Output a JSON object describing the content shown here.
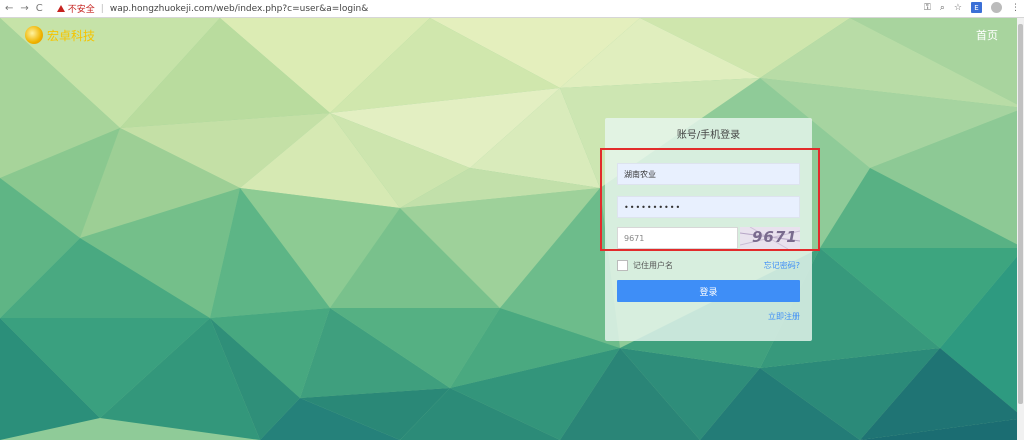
{
  "browser": {
    "back": "←",
    "forward": "→",
    "reload": "C",
    "security_label": "不安全",
    "separator": "|",
    "url": "wap.hongzhuokeji.com/web/index.php?c=user&a=login&",
    "icons": [
      "key-icon",
      "zoom-icon",
      "star-icon",
      "extension-icon",
      "profile-icon",
      "menu-icon"
    ]
  },
  "site": {
    "logo_text": "宏卓科技",
    "home_link": "首页"
  },
  "login": {
    "title": "账号/手机登录",
    "username_value": "湖南农业",
    "password_mask": "••••••••••",
    "captcha_input_value": "9671",
    "captcha_image_text": "9671",
    "remember_label": "记住用户名",
    "forgot_label": "忘记密码?",
    "submit_label": "登录",
    "register_label": "立即注册"
  },
  "colors": {
    "accent": "#3e8ef7",
    "highlight": "#e22b2b",
    "logo": "#f5c400"
  }
}
